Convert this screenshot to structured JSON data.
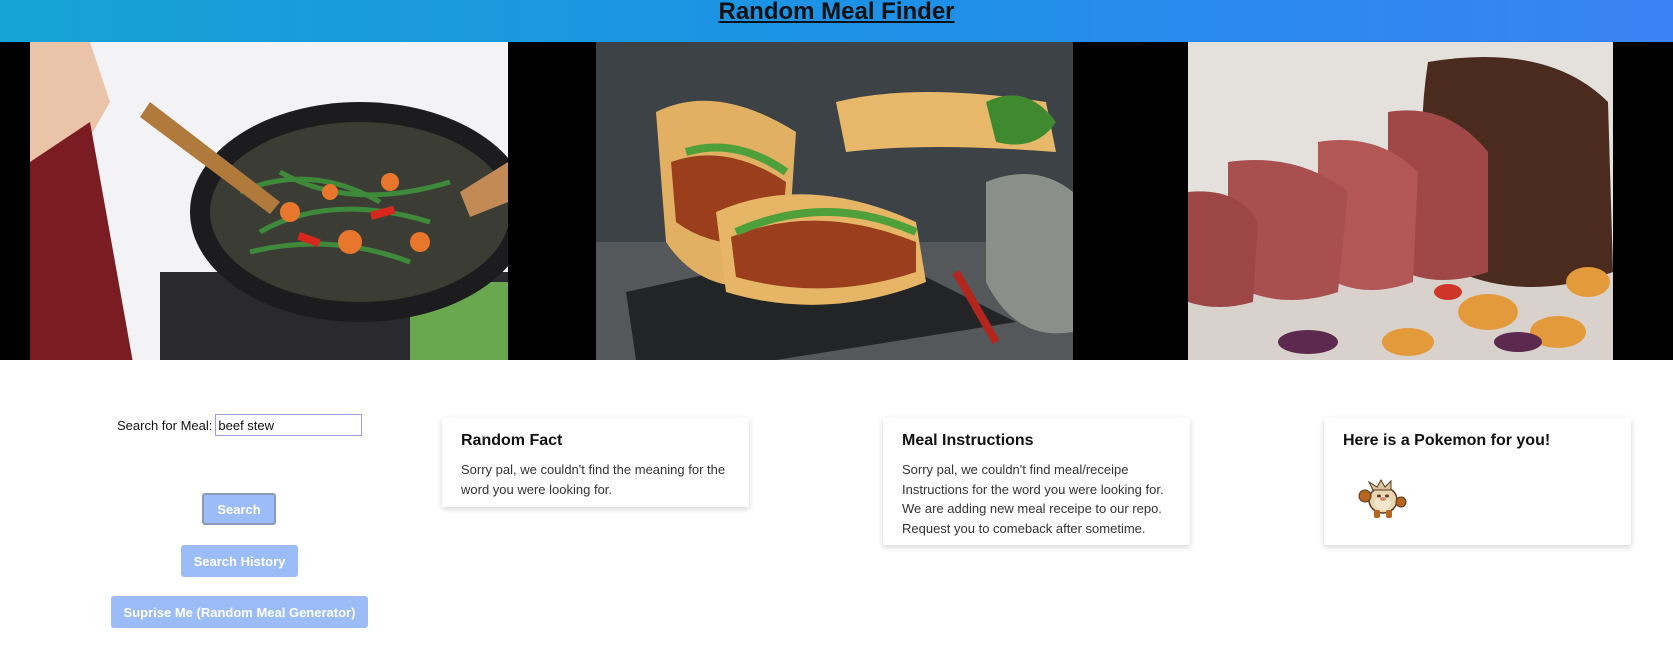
{
  "header": {
    "title": "Random Meal Finder"
  },
  "banner": {
    "images": [
      {
        "name": "stir-fry-wok-photo"
      },
      {
        "name": "banh-mi-sandwich-photo"
      },
      {
        "name": "roast-beef-photo"
      }
    ]
  },
  "search": {
    "label": "Search for Meal:",
    "value": "beef stew",
    "search_button": "Search",
    "history_button": "Search History",
    "surprise_button": "Suprise Me (Random Meal Generator)"
  },
  "fact_card": {
    "title": "Random Fact",
    "body": "Sorry pal, we couldn't find the meaning for the word you were looking for."
  },
  "meal_card": {
    "title": "Meal Instructions",
    "body": "Sorry pal, we couldn't find meal/receipe Instructions for the word you were looking for. We are adding new meal receipe to our repo. Request you to comeback after sometime."
  },
  "pokemon_card": {
    "title": "Here is a Pokemon for you!",
    "sprite_icon": "pokemon-sprite-icon"
  },
  "colors": {
    "header_start": "#16a3d4",
    "header_end": "#3b82f6",
    "button_bg": "#9bbcf6",
    "input_border": "#9e9adf"
  }
}
